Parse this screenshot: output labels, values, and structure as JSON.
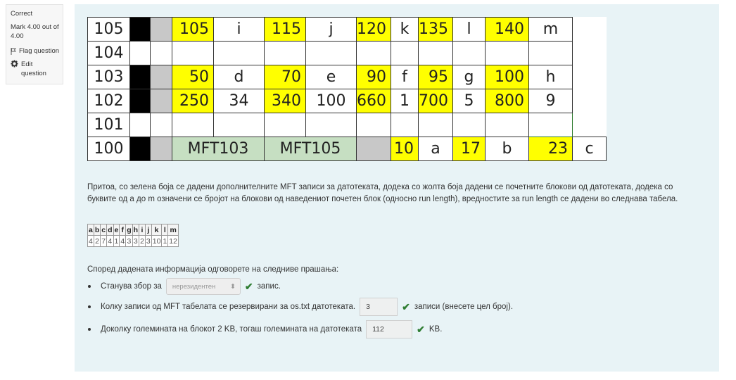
{
  "info": {
    "status": "Correct",
    "mark": "Mark 4.00 out of 4.00",
    "flag": "Flag question",
    "edit": "Edit question"
  },
  "grid": {
    "rows": [
      {
        "label": "105",
        "cells": [
          {
            "t": "num",
            "v": "105"
          },
          {
            "t": "txt",
            "v": "i"
          },
          {
            "t": "num",
            "v": "115"
          },
          {
            "t": "txt",
            "v": "j"
          },
          {
            "t": "num",
            "v": "120"
          },
          {
            "t": "txt",
            "v": "k"
          },
          {
            "t": "num",
            "v": "135"
          },
          {
            "t": "txt",
            "v": "l"
          },
          {
            "t": "num",
            "v": "140"
          },
          {
            "t": "txt",
            "v": "m"
          }
        ]
      },
      {
        "label": "104"
      },
      {
        "label": "103",
        "cells": [
          {
            "t": "num",
            "v": "50"
          },
          {
            "t": "txt",
            "v": "d"
          },
          {
            "t": "num",
            "v": "70"
          },
          {
            "t": "txt",
            "v": "e"
          },
          {
            "t": "num",
            "v": "90"
          },
          {
            "t": "txt",
            "v": "f"
          },
          {
            "t": "num",
            "v": "95"
          },
          {
            "t": "txt",
            "v": "g"
          },
          {
            "t": "num",
            "v": "100"
          },
          {
            "t": "txt",
            "v": "h"
          }
        ]
      },
      {
        "label": "102",
        "cells": [
          {
            "t": "num",
            "v": "250"
          },
          {
            "t": "txt",
            "v": "34"
          },
          {
            "t": "num",
            "v": "340"
          },
          {
            "t": "txt",
            "v": "100"
          },
          {
            "t": "num",
            "v": "660"
          },
          {
            "t": "txt",
            "v": "1"
          },
          {
            "t": "num",
            "v": "700"
          },
          {
            "t": "txt",
            "v": "5"
          },
          {
            "t": "num",
            "v": "800"
          },
          {
            "t": "txt",
            "v": "9"
          }
        ]
      },
      {
        "label": "101"
      },
      {
        "label": "100",
        "mft": [
          "MFT103",
          "MFT105"
        ],
        "cells": [
          {
            "t": "num",
            "v": "10"
          },
          {
            "t": "txt",
            "v": "a"
          },
          {
            "t": "num",
            "v": "17"
          },
          {
            "t": "txt",
            "v": "b"
          },
          {
            "t": "num",
            "v": "23"
          },
          {
            "t": "txt",
            "v": "c"
          }
        ]
      }
    ]
  },
  "description": "Притоа, со зелена боја се дадени дополнителните MFT записи за датотеката, додека со жолта боја дадени се почетните блокови од датотеката, додека со буквите од а до m означени се бројот на блокови од наведениот почетен блок (односно run length), вредностите за run length се дадени во следнава табела.",
  "run_table": {
    "headers": [
      "a",
      "b",
      "c",
      "d",
      "e",
      "f",
      "g",
      "h",
      "i",
      "j",
      "k",
      "l",
      "m"
    ],
    "values": [
      "4",
      "2",
      "7",
      "4",
      "1",
      "4",
      "3",
      "3",
      "2",
      "3",
      "10",
      "1",
      "12"
    ]
  },
  "prompt": "Според дадената информација одговорете на следниве прашања:",
  "questions": [
    {
      "before": "Станува збор за",
      "select_value": "нерезидентен",
      "after": "запис."
    },
    {
      "before": "Колку записи од MFT табелата се резервирани за os.txt датотеката.",
      "input_value": "3",
      "after": "записи (внесете цел број)."
    },
    {
      "before": "Доколку големината на блокот 2 KB, тогаш големината на датотеката",
      "input_value": "112",
      "after": "KB."
    }
  ]
}
